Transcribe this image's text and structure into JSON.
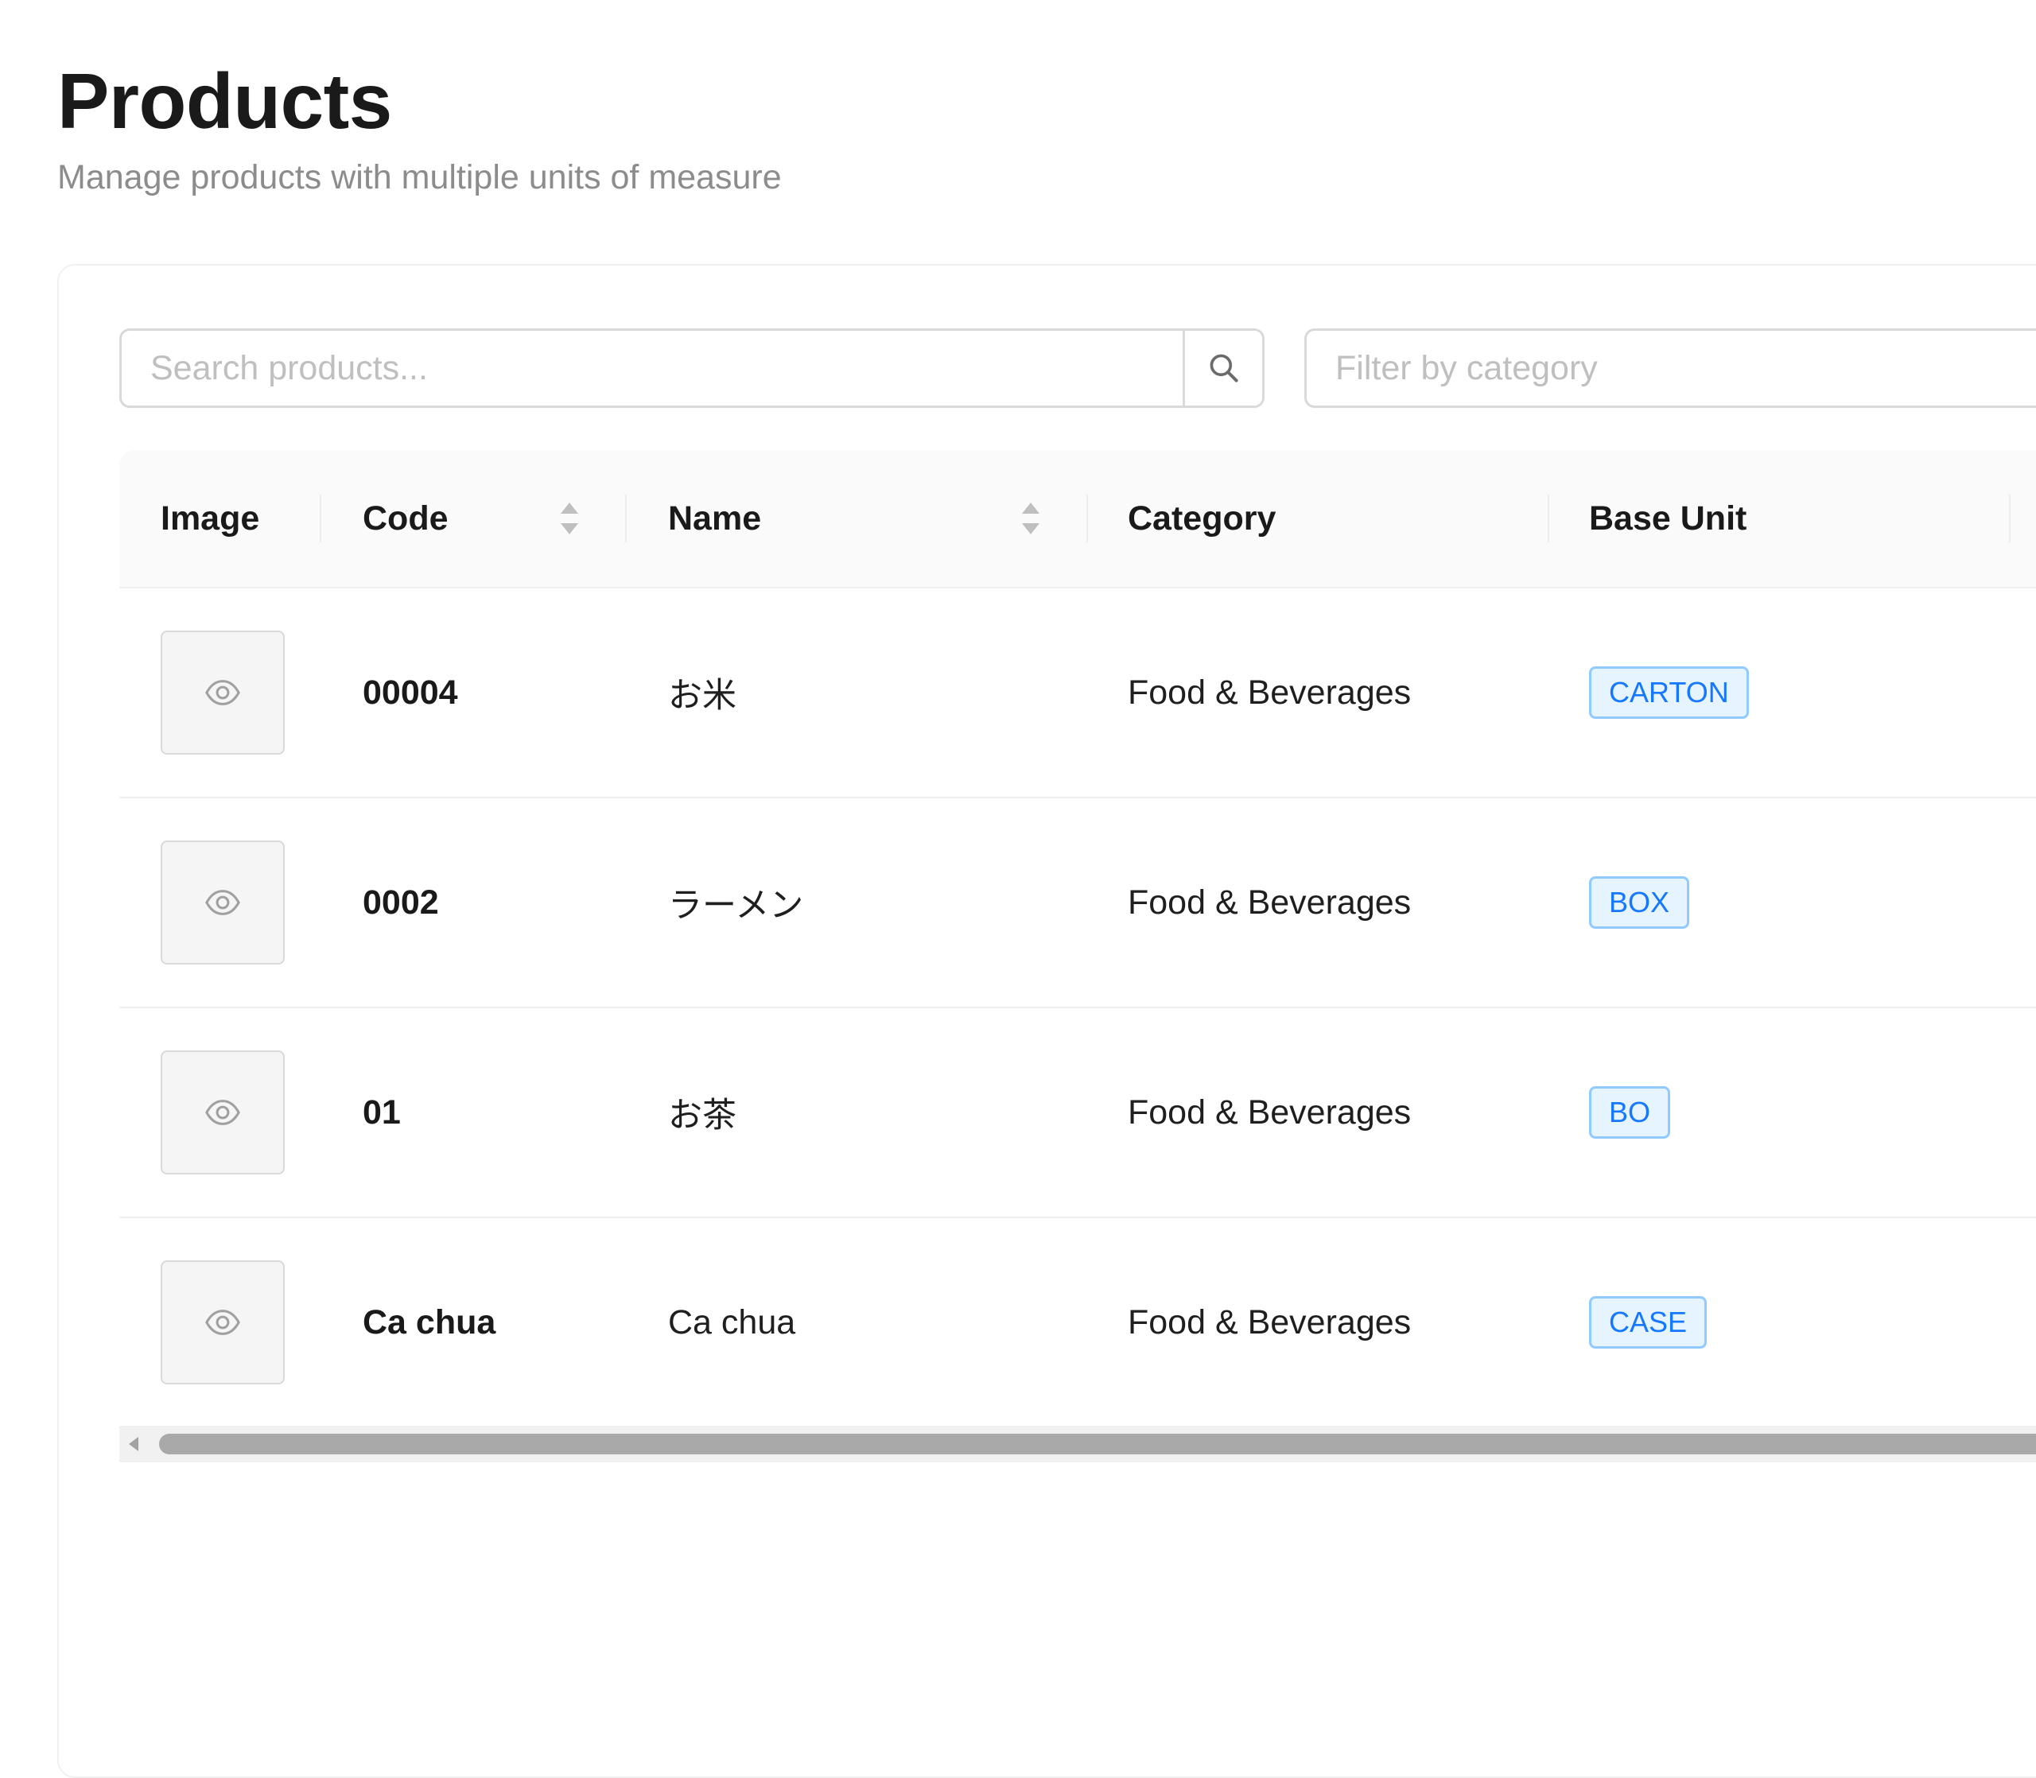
{
  "page": {
    "title": "Products",
    "subtitle": "Manage products with multiple units of measure"
  },
  "toolbar": {
    "search_placeholder": "Search products...",
    "search_icon": "search-icon",
    "filter_placeholder": "Filter by category"
  },
  "table": {
    "columns": [
      {
        "label": "Image",
        "sortable": false
      },
      {
        "label": "Code",
        "sortable": true
      },
      {
        "label": "Name",
        "sortable": true
      },
      {
        "label": "Category",
        "sortable": false
      },
      {
        "label": "Base Unit",
        "sortable": false
      }
    ],
    "rows": [
      {
        "image_icon": "eye-icon",
        "code": "00004",
        "name": "お米",
        "category": "Food & Beverages",
        "base_unit": "CARTON"
      },
      {
        "image_icon": "eye-icon",
        "code": "0002",
        "name": "ラーメン",
        "category": "Food & Beverages",
        "base_unit": "BOX"
      },
      {
        "image_icon": "eye-icon",
        "code": "01",
        "name": "お茶",
        "category": "Food & Beverages",
        "base_unit": "BO"
      },
      {
        "image_icon": "eye-icon",
        "code": "Ca chua",
        "name": "Ca chua",
        "category": "Food & Beverages",
        "base_unit": "CASE"
      }
    ]
  },
  "colors": {
    "tag_text": "#1677ff",
    "tag_background": "#e6f4ff",
    "tag_border": "#91caff",
    "subtitle": "#8c8c8c",
    "header_background": "#fafafa"
  }
}
